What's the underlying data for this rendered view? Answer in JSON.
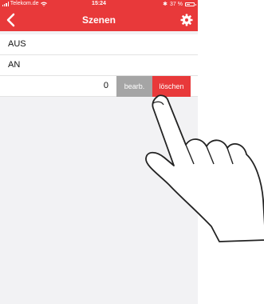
{
  "statusbar": {
    "carrier": "Telekom.de",
    "time": "15:24",
    "battery": "37 %"
  },
  "navbar": {
    "title": "Szenen",
    "back_icon": "chevron-left-icon",
    "settings_icon": "gear-icon"
  },
  "list": {
    "rows": [
      {
        "label": "AUS"
      },
      {
        "label": "AN"
      },
      {
        "count": "0",
        "edit_label": "bearb.",
        "delete_label": "löschen"
      }
    ]
  },
  "colors": {
    "accent": "#e8393a",
    "edit_gray": "#a5a5a5",
    "background": "#f2f2f4"
  }
}
